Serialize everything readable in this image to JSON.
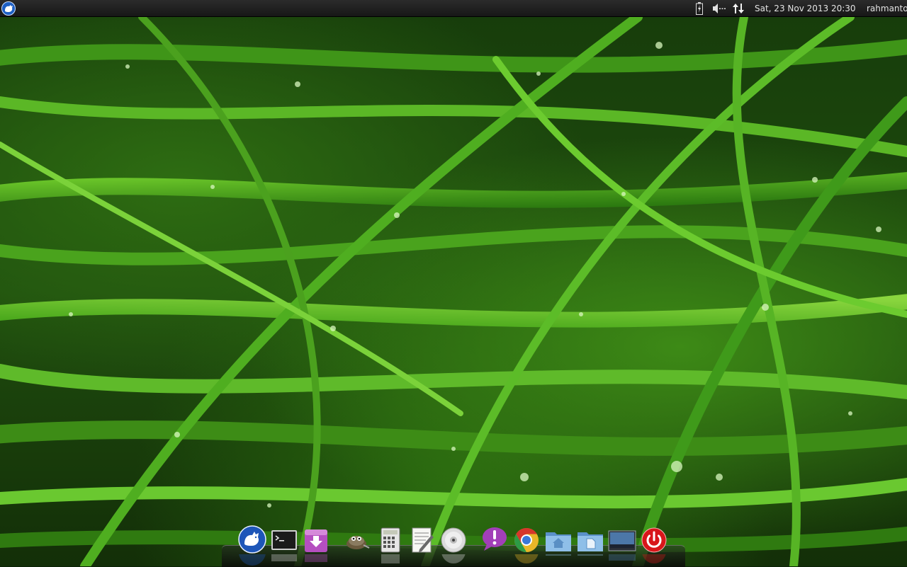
{
  "top_panel": {
    "menu_icon": "xfce-mouse-icon",
    "tray_icons": [
      "battery-icon",
      "volume-icon",
      "network-icon"
    ],
    "clock": "Sat, 23 Nov 2013 20:30",
    "username": "rahmanto"
  },
  "dock": {
    "items": [
      {
        "name": "xfce-menu",
        "icon": "xfce-mouse-icon"
      },
      {
        "name": "terminal",
        "icon": "terminal-icon"
      },
      {
        "name": "download-manager",
        "icon": "download-icon"
      },
      {
        "name": "gimp",
        "icon": "gimp-icon"
      },
      {
        "name": "calculator",
        "icon": "calculator-icon"
      },
      {
        "name": "text-editor",
        "icon": "text-editor-icon"
      },
      {
        "name": "disc-burner",
        "icon": "disc-icon"
      },
      {
        "name": "messaging",
        "icon": "chat-bubble-icon"
      },
      {
        "name": "chrome",
        "icon": "chrome-icon"
      },
      {
        "name": "home-folder",
        "icon": "home-folder-icon"
      },
      {
        "name": "documents-folder",
        "icon": "documents-folder-icon"
      },
      {
        "name": "show-desktop",
        "icon": "desktop-icon"
      },
      {
        "name": "shutdown",
        "icon": "power-icon"
      }
    ]
  },
  "colors": {
    "panel_bg": "#1e1e1e",
    "wallpaper_green": "#3d8a16",
    "power_red": "#d8161a",
    "chat_purple": "#a23fb8"
  }
}
